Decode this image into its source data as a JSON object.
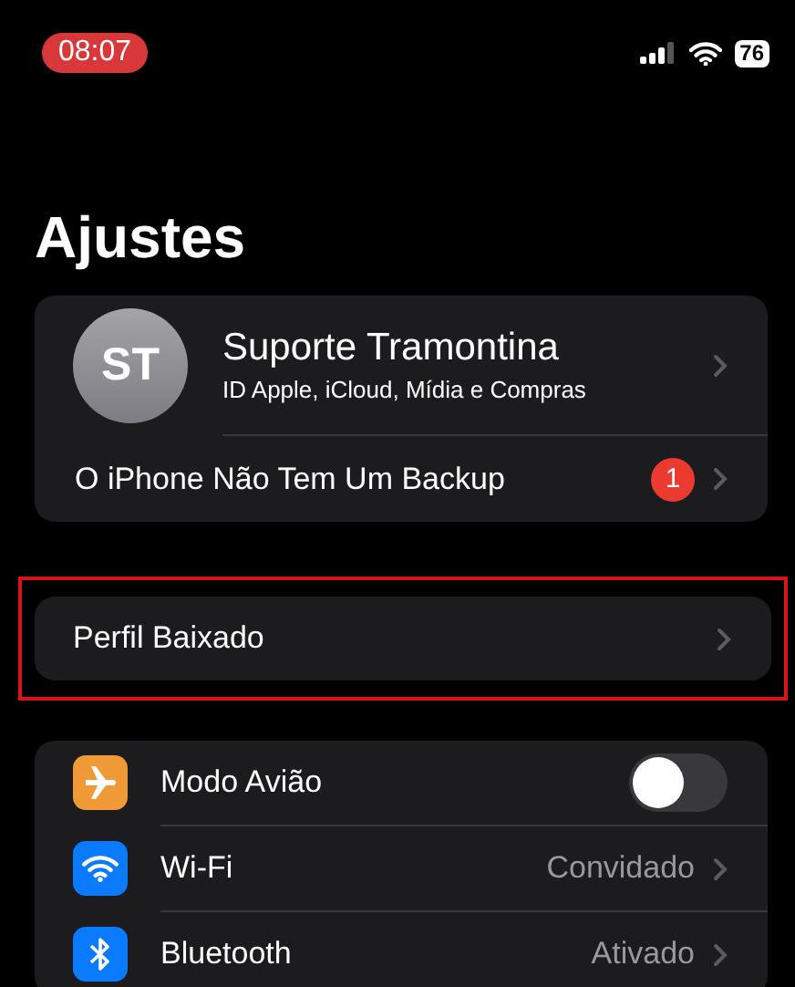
{
  "status_bar": {
    "time": "08:07",
    "battery": "76"
  },
  "title": "Ajustes",
  "account": {
    "initials": "ST",
    "name": "Suporte Tramontina",
    "subtitle": "ID Apple, iCloud, Mídia e Compras",
    "notice": "O iPhone Não Tem Um Backup",
    "notice_badge": "1"
  },
  "profile": {
    "label": "Perfil Baixado",
    "highlighted": true
  },
  "settings": [
    {
      "kind": "toggle",
      "color": "#f09a37",
      "label": "Modo Avião",
      "on": false
    },
    {
      "kind": "link",
      "color": "#0a7aff",
      "label": "Wi-Fi",
      "value": "Convidado"
    },
    {
      "kind": "link",
      "color": "#0a7aff",
      "label": "Bluetooth",
      "value": "Ativado"
    }
  ]
}
